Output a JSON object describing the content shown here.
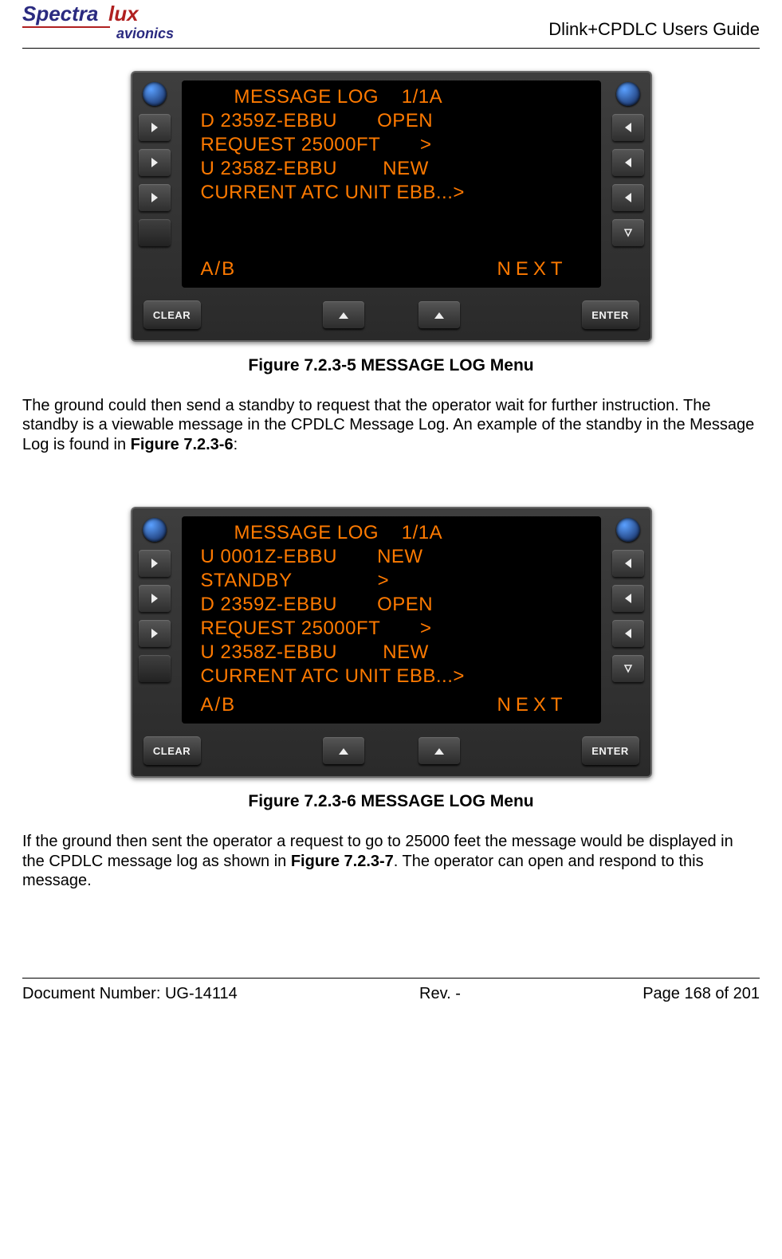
{
  "header": {
    "logo_main": "Spectralux",
    "logo_sub": "avionics",
    "doc_title": "Dlink+CPDLC Users Guide"
  },
  "figure1": {
    "caption": "Figure 7.2.3-5 MESSAGE LOG Menu",
    "screen": {
      "title": "MESSAGE LOG    1/1A",
      "lines": [
        "D 2359Z-EBBU       OPEN",
        "REQUEST 25000FT       >",
        "U 2358Z-EBBU        NEW",
        "CURRENT ATC UNIT EBB...>"
      ],
      "bottom_left": "A/B",
      "bottom_right": "NEXT"
    },
    "clear_label": "CLEAR",
    "enter_label": "ENTER"
  },
  "para1_a": "The ground could then send a standby to request that the operator wait for further instruction. The standby is a viewable message in the CPDLC Message Log.  An example of the standby in the Message Log is found in ",
  "para1_ref": "Figure 7.2.3-6",
  "para1_b": ":",
  "figure2": {
    "caption": "Figure 7.2.3-6 MESSAGE LOG Menu",
    "screen": {
      "title": "MESSAGE LOG    1/1A",
      "lines": [
        "U 0001Z-EBBU       NEW",
        "STANDBY               >",
        "D 2359Z-EBBU       OPEN",
        "REQUEST 25000FT       >",
        "U 2358Z-EBBU        NEW",
        "CURRENT ATC UNIT EBB...>"
      ],
      "bottom_left": "A/B",
      "bottom_right": "NEXT"
    },
    "clear_label": "CLEAR",
    "enter_label": "ENTER"
  },
  "para2_a": "If the ground then sent the operator a request to go to 25000 feet the message would be displayed in the CPDLC message log as shown in ",
  "para2_ref": "Figure 7.2.3-7",
  "para2_b": ".  The operator can open and respond to this message.",
  "footer": {
    "doc_num": "Document Number:  UG-14114",
    "rev": "Rev. -",
    "page": "Page 168 of 201"
  }
}
